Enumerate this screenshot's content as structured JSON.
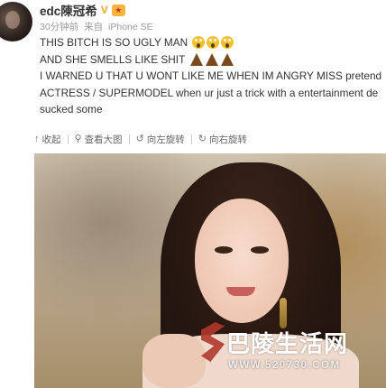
{
  "post": {
    "username": "edc陳冠希",
    "vip_badge": "V",
    "medal_icon": "medal-icon",
    "time": "30分钟前",
    "source_prefix": "来自",
    "source": "iPhone SE",
    "lines": [
      "THIS BITCH IS SO UGLY MAN",
      "AND SHE SMELLS LIKE SHIT",
      "I WARNED U THAT U WONT LIKE ME WHEN IM ANGRY MISS pretend",
      "ACTRESS / SUPERMODEL when ur just a trick with a entertainment de",
      "sucked some"
    ],
    "emoji_line1": [
      "scream-emoji",
      "scream-emoji",
      "scream-emoji"
    ],
    "emoji_line2": [
      "poop-emoji",
      "poop-emoji",
      "poop-emoji"
    ]
  },
  "actions": {
    "collapse_label": "收起",
    "view_large_label": "查看大图",
    "rotate_left_label": "向左旋转",
    "rotate_right_label": "向右旋转"
  },
  "watermark": {
    "title": "巴陵生活网",
    "url": "WWW.520730.COM"
  },
  "colors": {
    "text": "#333333",
    "meta": "#999999",
    "vip": "#f5a623",
    "watermark_logo": "#b0372c"
  }
}
